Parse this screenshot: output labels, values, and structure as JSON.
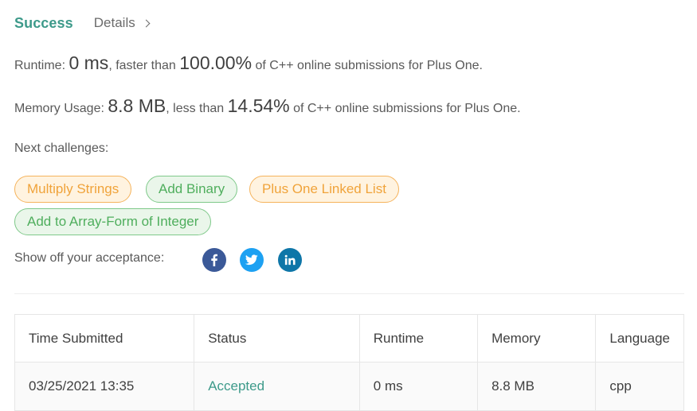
{
  "header": {
    "status": "Success",
    "details_link": "Details"
  },
  "runtime": {
    "label": "Runtime: ",
    "value": "0 ms",
    "mid_text": ", faster than ",
    "percent": "100.00%",
    "suffix": " of C++ online submissions for Plus One."
  },
  "memory": {
    "label": "Memory Usage: ",
    "value": "8.8 MB",
    "mid_text": ", less than ",
    "percent": "14.54%",
    "suffix": " of C++ online submissions for Plus One."
  },
  "next_challenges": {
    "title": "Next challenges:",
    "items": [
      {
        "label": "Multiply Strings",
        "difficulty_color": "#f0a33a"
      },
      {
        "label": "Add Binary",
        "difficulty_color": "#4fae5d"
      },
      {
        "label": "Plus One Linked List",
        "difficulty_color": "#f0a33a"
      },
      {
        "label": "Add to Array-Form of Integer",
        "difficulty_color": "#4fae5d"
      }
    ]
  },
  "share": {
    "label": "Show off your acceptance:",
    "icons": [
      "facebook-icon",
      "twitter-icon",
      "linkedin-icon"
    ]
  },
  "submissions": {
    "columns": [
      "Time Submitted",
      "Status",
      "Runtime",
      "Memory",
      "Language"
    ],
    "rows": [
      {
        "time": "03/25/2021 13:35",
        "status": "Accepted",
        "runtime": "0 ms",
        "memory": "8.8 MB",
        "language": "cpp"
      }
    ]
  },
  "colors": {
    "success": "#3d9a8a",
    "medium": "#f0a33a",
    "easy": "#4fae5d",
    "facebook": "#3b5998",
    "twitter": "#1da1f2",
    "linkedin": "#0e76a8"
  }
}
